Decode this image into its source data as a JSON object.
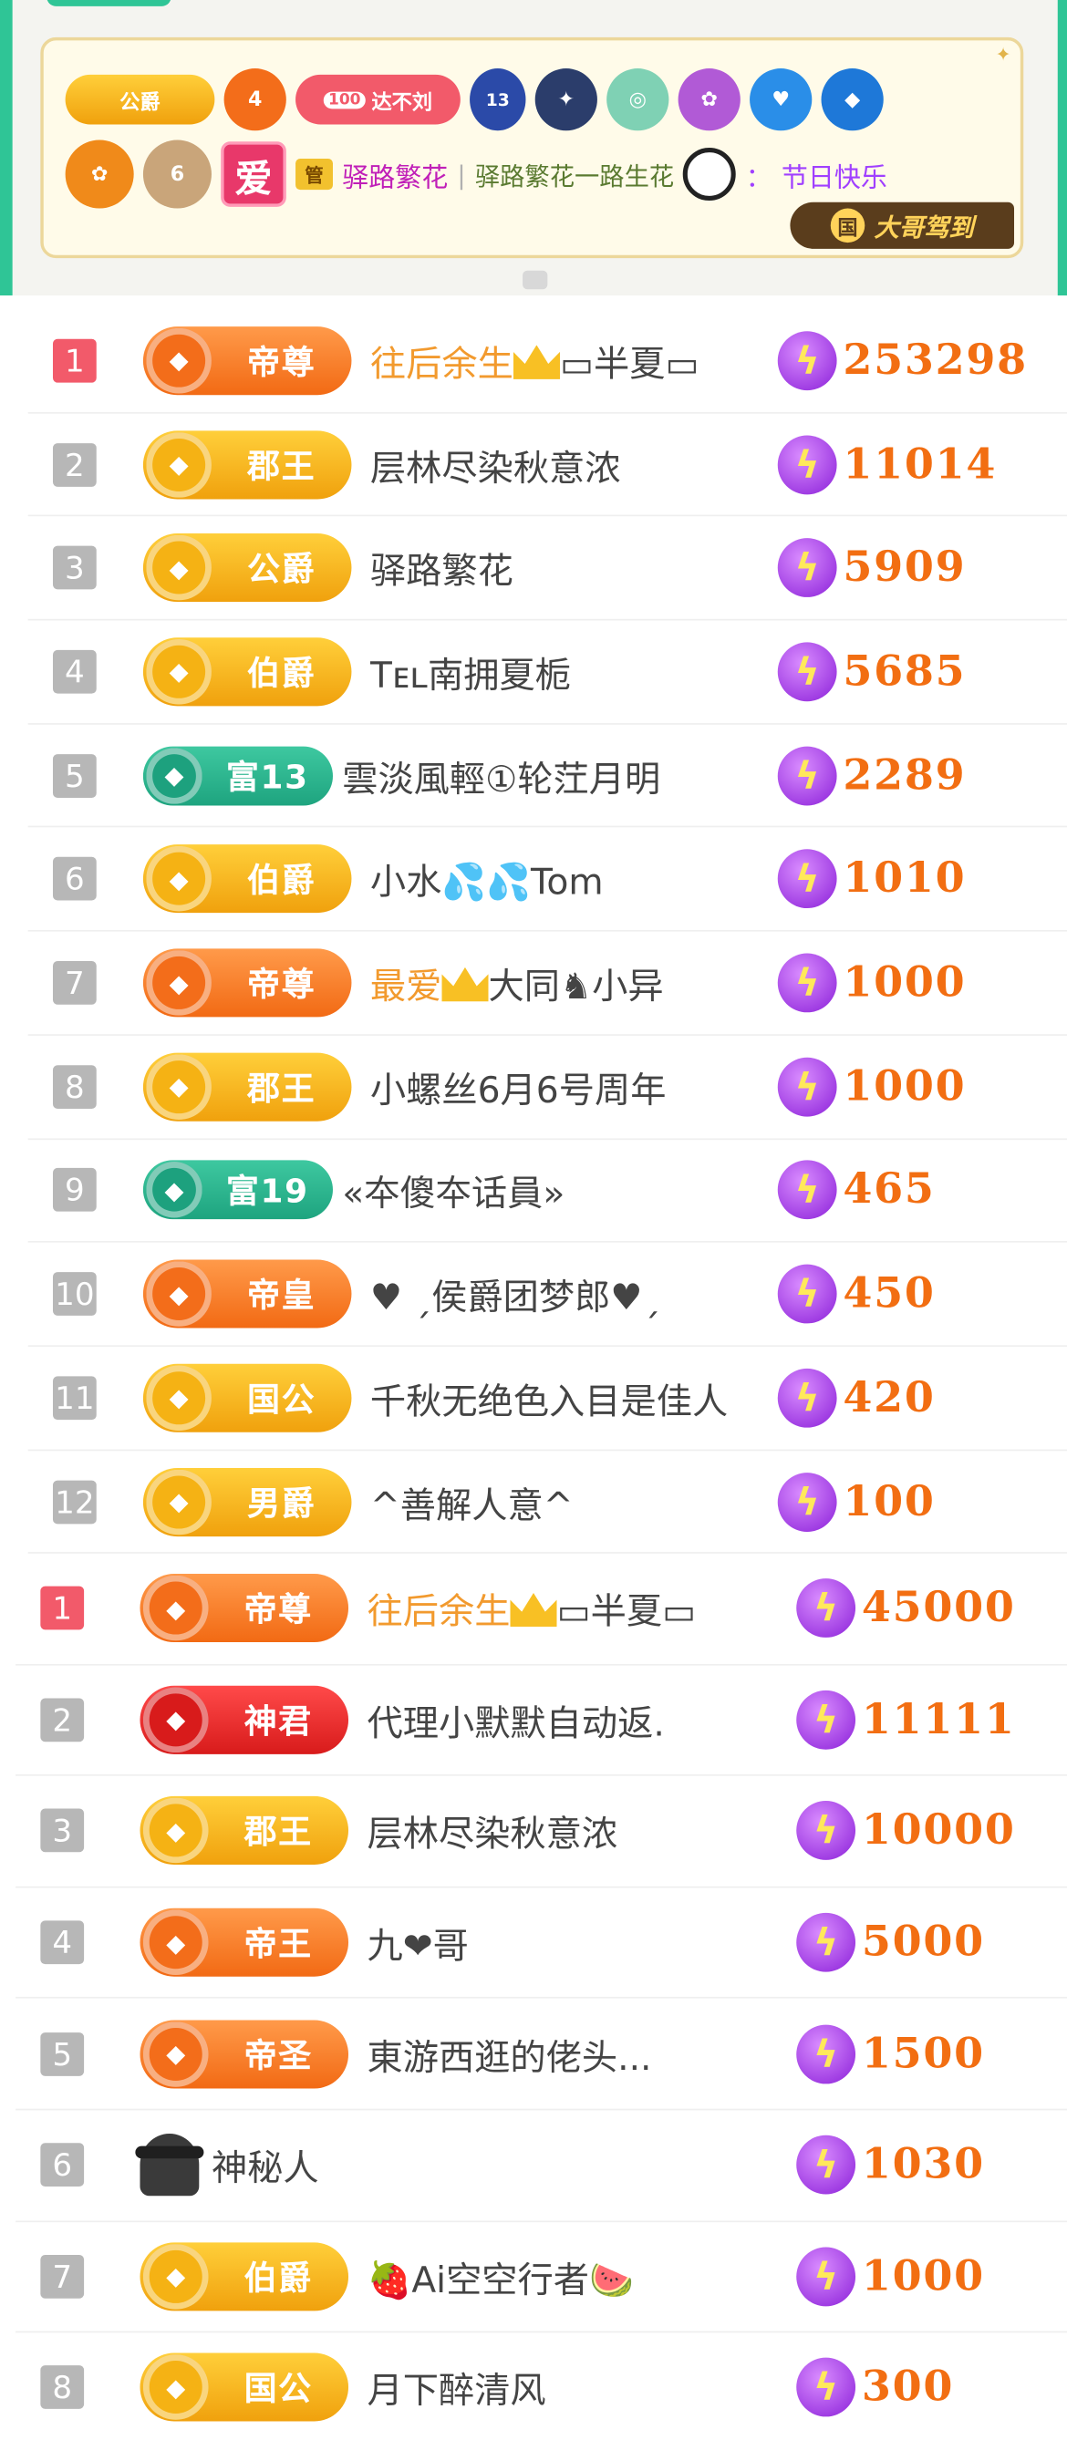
{
  "chat": {
    "badge_gong": "公爵",
    "badge_level": "4",
    "badge_100_num": "100",
    "badge_100_text": "达不刘",
    "badge_13": "13",
    "guan": "管",
    "ai_char": "爱",
    "username": "驿路繁花",
    "separator": "|",
    "message": "驿路繁花一路生花",
    "colon": "：",
    "text": "节日快乐",
    "checkin": "大哥驾到",
    "checkin_icon": "国"
  },
  "list1": [
    {
      "rank": "1",
      "badge": "帝尊",
      "style": "p-orange",
      "name_hl": "往后余生",
      "crown": true,
      "name": "▭半夏▭",
      "score": "253298"
    },
    {
      "rank": "2",
      "badge": "郡王",
      "style": "p-gold",
      "name_hl": "",
      "crown": false,
      "name": "层林尽染秋意浓",
      "score": "11014"
    },
    {
      "rank": "3",
      "badge": "公爵",
      "style": "p-gold",
      "name_hl": "",
      "crown": false,
      "name": "驿路繁花",
      "score": "5909"
    },
    {
      "rank": "4",
      "badge": "伯爵",
      "style": "p-gold",
      "name_hl": "",
      "crown": false,
      "name": "Tᴇʟ南拥夏栀",
      "score": "5685"
    },
    {
      "rank": "5",
      "badge": "富13",
      "style": "p-teal",
      "name_hl": "",
      "crown": false,
      "name": "雲淡風輕①轮茳月明",
      "score": "2289"
    },
    {
      "rank": "6",
      "badge": "伯爵",
      "style": "p-gold",
      "name_hl": "",
      "crown": false,
      "name": "小水💦💦Tom",
      "score": "1010"
    },
    {
      "rank": "7",
      "badge": "帝尊",
      "style": "p-orange",
      "name_hl": "最爱",
      "crown": true,
      "name": "大同♞小异",
      "score": "1000"
    },
    {
      "rank": "8",
      "badge": "郡王",
      "style": "p-gold",
      "name_hl": "",
      "crown": false,
      "name": "小螺丝6月6号周年",
      "score": "1000"
    },
    {
      "rank": "9",
      "badge": "富19",
      "style": "p-teal",
      "name_hl": "",
      "crown": false,
      "name": "«夲傻夲话員»",
      "score": "465"
    },
    {
      "rank": "10",
      "badge": "帝皇",
      "style": "p-orange",
      "name_hl": "",
      "crown": false,
      "name": "♥ ˏ侯爵团梦郎♥ˏ",
      "score": "450"
    },
    {
      "rank": "11",
      "badge": "国公",
      "style": "p-gold",
      "name_hl": "",
      "crown": false,
      "name": "千秋无绝色入目是佳人",
      "score": "420"
    },
    {
      "rank": "12",
      "badge": "男爵",
      "style": "p-gold",
      "name_hl": "",
      "crown": false,
      "name": "^善解人意^",
      "score": "100"
    }
  ],
  "list2": [
    {
      "rank": "1",
      "badge": "帝尊",
      "style": "p-orange",
      "name_hl": "往后余生",
      "crown": true,
      "name": "▭半夏▭",
      "score": "45000"
    },
    {
      "rank": "2",
      "badge": "神君",
      "style": "p-red",
      "name_hl": "",
      "crown": false,
      "name": "代理小默默自动返.",
      "score": "11111"
    },
    {
      "rank": "3",
      "badge": "郡王",
      "style": "p-gold",
      "name_hl": "",
      "crown": false,
      "name": "层林尽染秋意浓",
      "score": "10000"
    },
    {
      "rank": "4",
      "badge": "帝王",
      "style": "p-orange",
      "name_hl": "",
      "crown": false,
      "name": "九❤哥",
      "score": "5000"
    },
    {
      "rank": "5",
      "badge": "帝圣",
      "style": "p-orange",
      "name_hl": "",
      "crown": false,
      "name": "東游西逛的佬头...",
      "score": "1500"
    },
    {
      "rank": "6",
      "badge": "",
      "style": "",
      "name_hl": "",
      "crown": false,
      "name": "神秘人",
      "score": "1030"
    },
    {
      "rank": "7",
      "badge": "伯爵",
      "style": "p-gold",
      "name_hl": "",
      "crown": false,
      "name": "🍓Ai空空行者🍉",
      "score": "1000"
    },
    {
      "rank": "8",
      "badge": "国公",
      "style": "p-gold",
      "name_hl": "",
      "crown": false,
      "name": "月下醉清风",
      "score": "300"
    }
  ]
}
